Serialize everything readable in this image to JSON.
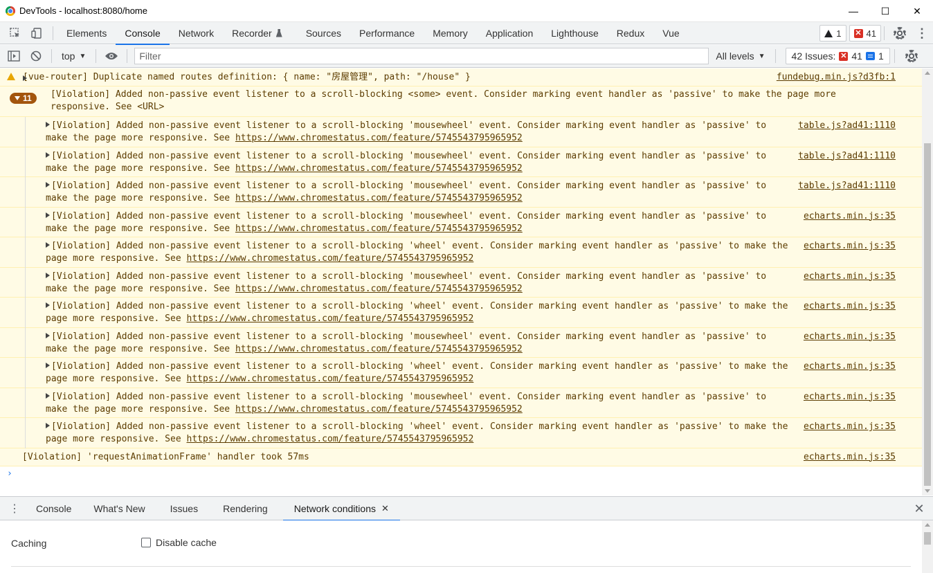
{
  "window": {
    "title": "DevTools - localhost:8080/home",
    "minimize_glyph": "—",
    "maximize_glyph": "☐",
    "close_glyph": "✕"
  },
  "main_tabs": [
    {
      "label": "Elements",
      "active": false
    },
    {
      "label": "Console",
      "active": true
    },
    {
      "label": "Network",
      "active": false
    },
    {
      "label": "Recorder",
      "active": false
    },
    {
      "label": "Sources",
      "active": false
    },
    {
      "label": "Performance",
      "active": false
    },
    {
      "label": "Memory",
      "active": false
    },
    {
      "label": "Application",
      "active": false
    },
    {
      "label": "Lighthouse",
      "active": false
    },
    {
      "label": "Redux",
      "active": false
    },
    {
      "label": "Vue",
      "active": false
    }
  ],
  "badges": {
    "warnings": "1",
    "errors": "41"
  },
  "console_toolbar": {
    "context": "top",
    "filter_placeholder": "Filter",
    "levels": "All levels",
    "issues_label": "42 Issues:",
    "issues_errors": "41",
    "issues_info": "1"
  },
  "messages": {
    "warning": {
      "text": "[vue-router] Duplicate named routes definition: { name: \"房屋管理\", path: \"/house\" }",
      "source": "fundebug.min.js?d3fb:1"
    },
    "group": {
      "count": "11",
      "text": "[Violation] Added non-passive event listener to a scroll-blocking <some> event. Consider marking event handler as 'passive' to make the page more responsive. See <URL>"
    },
    "children": [
      {
        "text": "[Violation] Added non-passive event listener to a scroll-blocking 'mousewheel' event. Consider marking event handler as 'passive' to make the page more responsive. See ",
        "url": "https://www.chromestatus.com/feature/5745543795965952",
        "source": "table.js?ad41:1110"
      },
      {
        "text": "[Violation] Added non-passive event listener to a scroll-blocking 'mousewheel' event. Consider marking event handler as 'passive' to make the page more responsive. See ",
        "url": "https://www.chromestatus.com/feature/5745543795965952",
        "source": "table.js?ad41:1110"
      },
      {
        "text": "[Violation] Added non-passive event listener to a scroll-blocking 'mousewheel' event. Consider marking event handler as 'passive' to make the page more responsive. See ",
        "url": "https://www.chromestatus.com/feature/5745543795965952",
        "source": "table.js?ad41:1110"
      },
      {
        "text": "[Violation] Added non-passive event listener to a scroll-blocking 'mousewheel' event. Consider marking event handler as 'passive' to make the page more responsive. See ",
        "url": "https://www.chromestatus.com/feature/5745543795965952",
        "source": "echarts.min.js:35"
      },
      {
        "text": "[Violation] Added non-passive event listener to a scroll-blocking 'wheel' event. Consider marking event handler as 'passive' to make the page more responsive. See ",
        "url": "https://www.chromestatus.com/feature/5745543795965952",
        "source": "echarts.min.js:35"
      },
      {
        "text": "[Violation] Added non-passive event listener to a scroll-blocking 'mousewheel' event. Consider marking event handler as 'passive' to make the page more responsive. See ",
        "url": "https://www.chromestatus.com/feature/5745543795965952",
        "source": "echarts.min.js:35"
      },
      {
        "text": "[Violation] Added non-passive event listener to a scroll-blocking 'wheel' event. Consider marking event handler as 'passive' to make the page more responsive. See ",
        "url": "https://www.chromestatus.com/feature/5745543795965952",
        "source": "echarts.min.js:35"
      },
      {
        "text": "[Violation] Added non-passive event listener to a scroll-blocking 'mousewheel' event. Consider marking event handler as 'passive' to make the page more responsive. See ",
        "url": "https://www.chromestatus.com/feature/5745543795965952",
        "source": "echarts.min.js:35"
      },
      {
        "text": "[Violation] Added non-passive event listener to a scroll-blocking 'wheel' event. Consider marking event handler as 'passive' to make the page more responsive. See ",
        "url": "https://www.chromestatus.com/feature/5745543795965952",
        "source": "echarts.min.js:35"
      },
      {
        "text": "[Violation] Added non-passive event listener to a scroll-blocking 'mousewheel' event. Consider marking event handler as 'passive' to make the page more responsive. See ",
        "url": "https://www.chromestatus.com/feature/5745543795965952",
        "source": "echarts.min.js:35"
      },
      {
        "text": "[Violation] Added non-passive event listener to a scroll-blocking 'wheel' event. Consider marking event handler as 'passive' to make the page more responsive. See ",
        "url": "https://www.chromestatus.com/feature/5745543795965952",
        "source": "echarts.min.js:35"
      }
    ],
    "raf": {
      "text": "[Violation] 'requestAnimationFrame' handler took 57ms",
      "source": "echarts.min.js:35"
    },
    "prompt": "›"
  },
  "drawer": {
    "tabs": [
      {
        "label": "Console",
        "active": false
      },
      {
        "label": "What's New",
        "active": false
      },
      {
        "label": "Issues",
        "active": false
      },
      {
        "label": "Rendering",
        "active": false
      },
      {
        "label": "Network conditions",
        "active": true
      }
    ],
    "tab_close_glyph": "✕",
    "close_glyph": "✕",
    "caching_label": "Caching",
    "disable_cache_label": "Disable cache",
    "disable_cache_checked": false
  }
}
